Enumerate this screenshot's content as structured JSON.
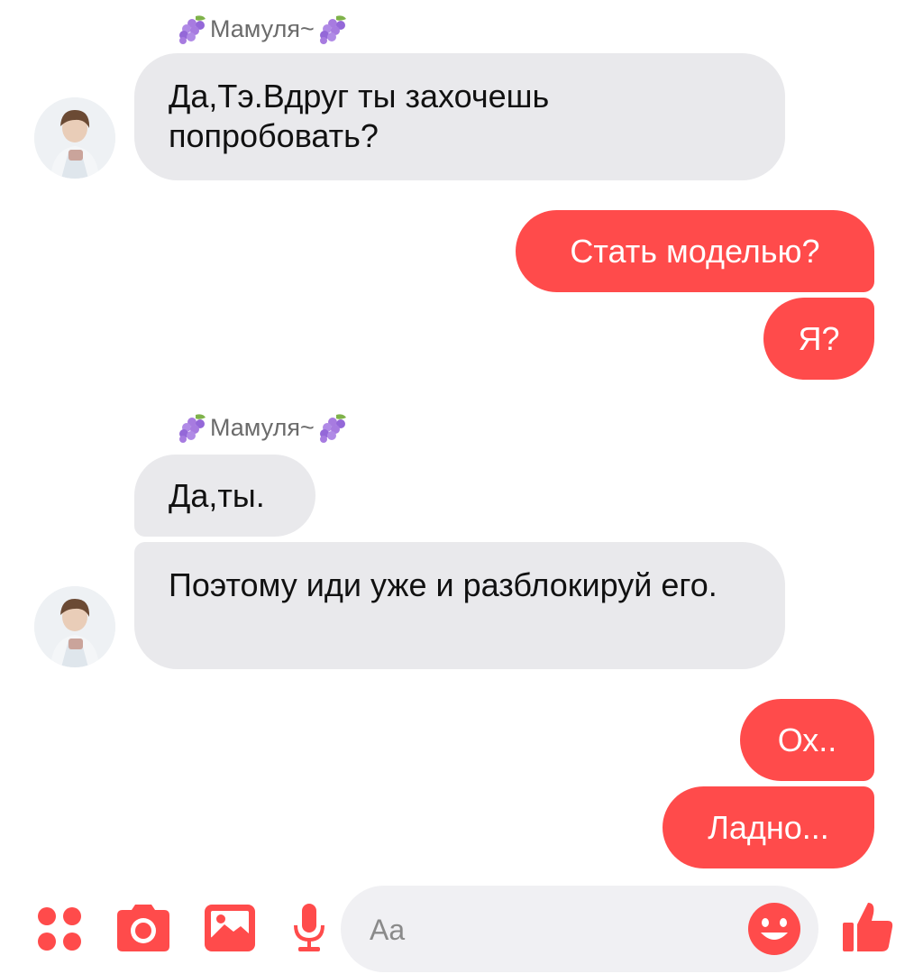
{
  "colors": {
    "accent": "#ff4b4b",
    "incoming_bubble": "#e9e9ec",
    "background": "#ffffff"
  },
  "messages": [
    {
      "sender": "Мамуля~",
      "direction": "in",
      "text": "Да,Тэ.Вдруг ты захочешь попробовать?"
    },
    {
      "direction": "out",
      "text": "Стать моделью?"
    },
    {
      "direction": "out",
      "text": "Я?"
    },
    {
      "sender": "Мамуля~",
      "direction": "in",
      "text": "Да,ты."
    },
    {
      "direction": "in",
      "text": "Поэтому иди уже и разблокируй его."
    },
    {
      "direction": "out",
      "text": "Ох.."
    },
    {
      "direction": "out",
      "text": "Ладно..."
    }
  ],
  "composer": {
    "placeholder": "Aa",
    "icons": [
      "apps-icon",
      "camera-icon",
      "image-icon",
      "microphone-icon",
      "emoji-icon",
      "thumbs-up-icon"
    ]
  }
}
